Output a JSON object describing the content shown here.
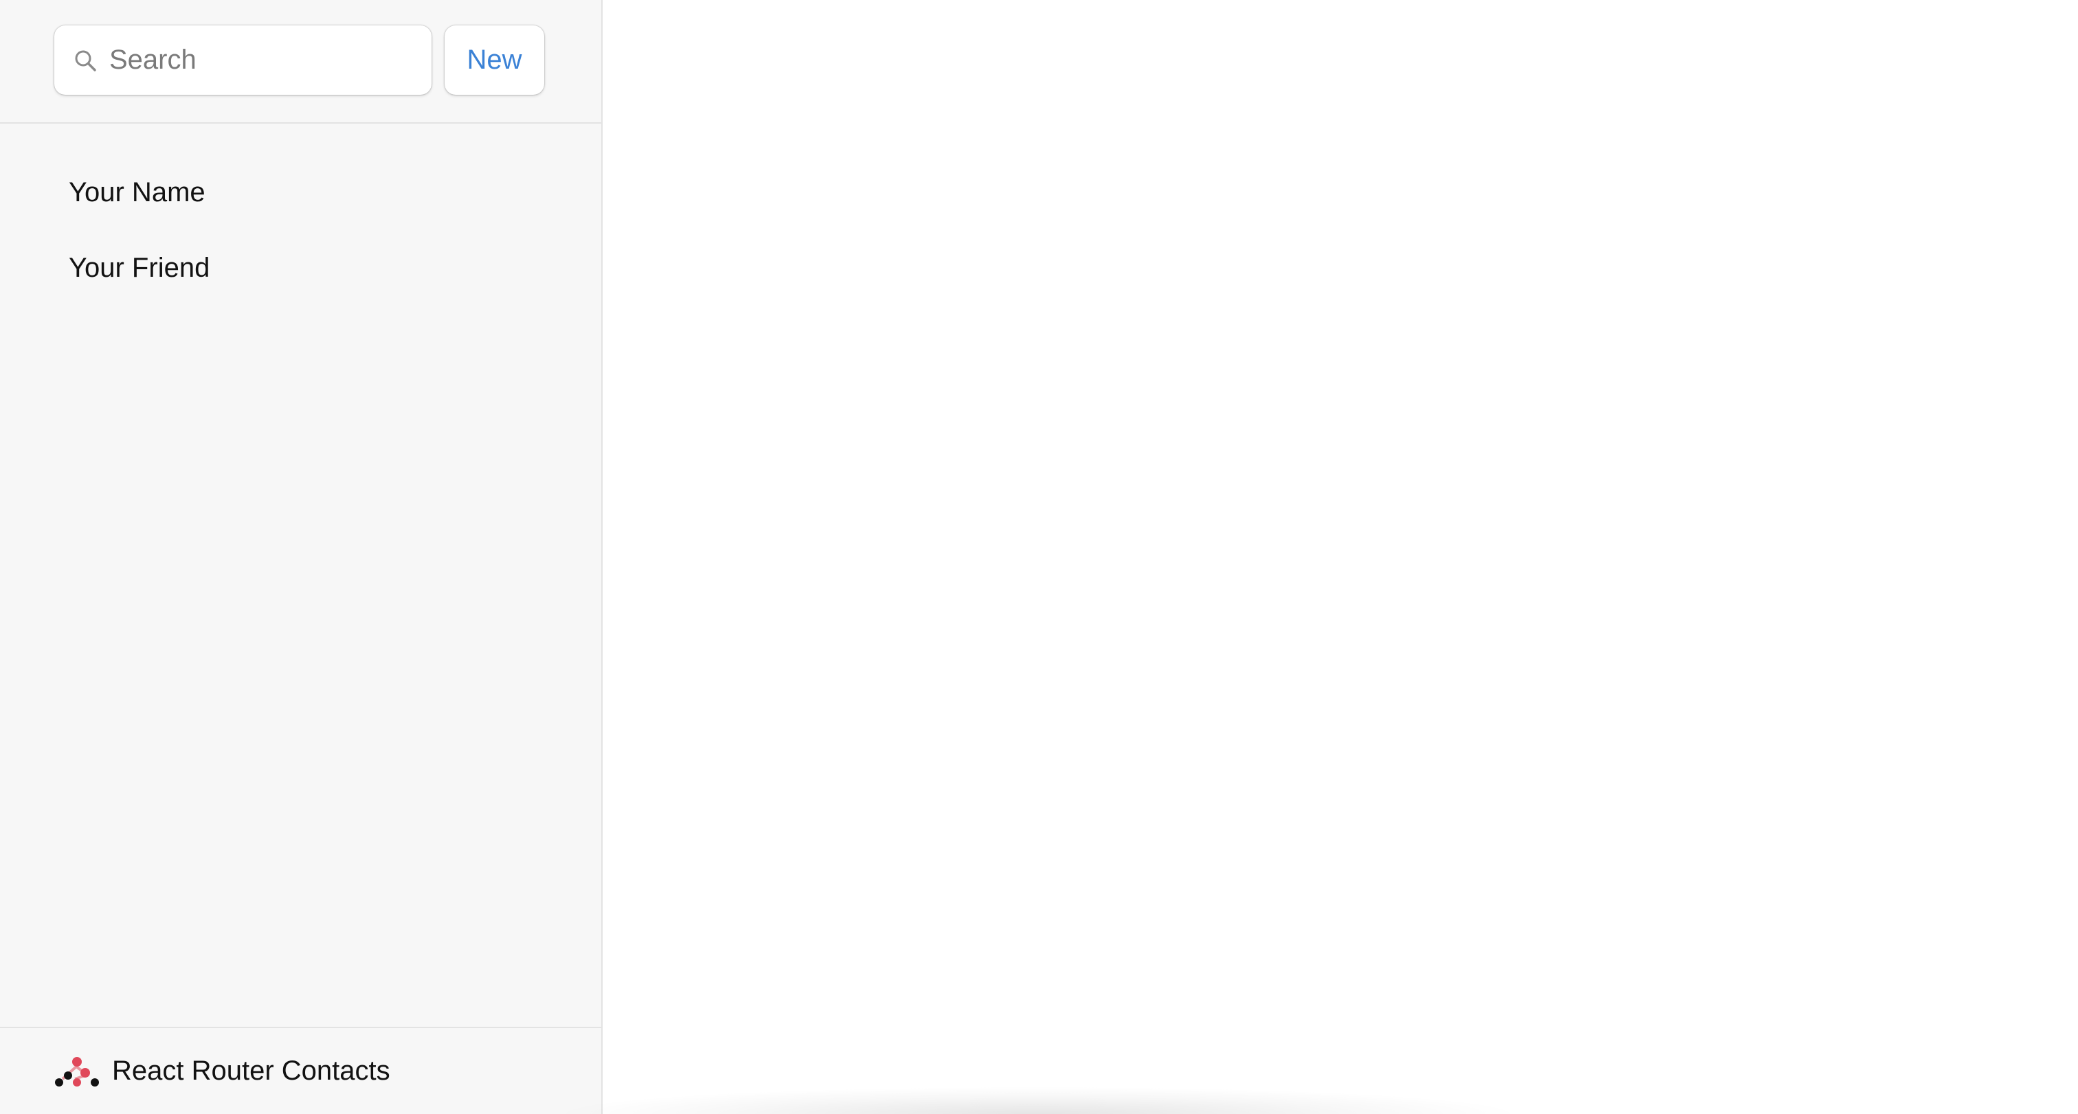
{
  "search": {
    "placeholder": "Search",
    "value": ""
  },
  "toolbar": {
    "new_label": "New"
  },
  "contacts": [
    {
      "name": "Your Name"
    },
    {
      "name": "Your Friend"
    }
  ],
  "footer": {
    "title": "React Router Contacts",
    "logo_icon": "react-router-logo-icon"
  },
  "colors": {
    "accent": "#3b82d6",
    "sidebar_bg": "#f7f7f7",
    "logo_red": "#e0485a",
    "logo_dark": "#121212"
  }
}
